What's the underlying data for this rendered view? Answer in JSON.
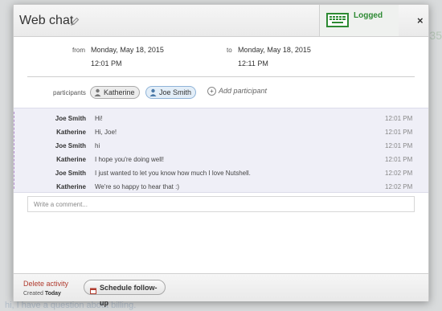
{
  "header": {
    "title": "Web chat",
    "logged_label": "Logged",
    "close_symbol": "×"
  },
  "time": {
    "from_label": "from",
    "from_date": "Monday, May 18, 2015",
    "from_time": "12:01 PM",
    "to_label": "to",
    "to_date": "Monday, May 18, 2015",
    "to_time": "12:11 PM"
  },
  "participants": {
    "label": "participants",
    "items": [
      {
        "name": "Katherine"
      },
      {
        "name": "Joe Smith"
      }
    ],
    "add_label": "Add participant"
  },
  "messages": [
    {
      "sender": "Joe Smith",
      "text": "Hi!",
      "time": "12:01 PM"
    },
    {
      "sender": "Katherine",
      "text": "Hi, Joe!",
      "time": "12:01 PM"
    },
    {
      "sender": "Joe Smith",
      "text": "hi",
      "time": "12:01 PM"
    },
    {
      "sender": "Katherine",
      "text": "I hope you're doing well!",
      "time": "12:01 PM"
    },
    {
      "sender": "Joe Smith",
      "text": "I just wanted to let you know how much I love Nutshell.",
      "time": "12:02 PM"
    },
    {
      "sender": "Katherine",
      "text": "We're so happy to hear that :)",
      "time": "12:02 PM"
    }
  ],
  "comment": {
    "placeholder": "Write a comment..."
  },
  "footer": {
    "delete_label": "Delete activity",
    "created_prefix": "Created",
    "created_value": "Today",
    "schedule_label": "Schedule follow-up"
  },
  "background": {
    "bottom_snippet": "hi, I have a question about billing.",
    "right_number": "35"
  },
  "colors": {
    "logged": "#2d8a33",
    "delete": "#b03b2e",
    "message_bg": "#efeff7"
  }
}
